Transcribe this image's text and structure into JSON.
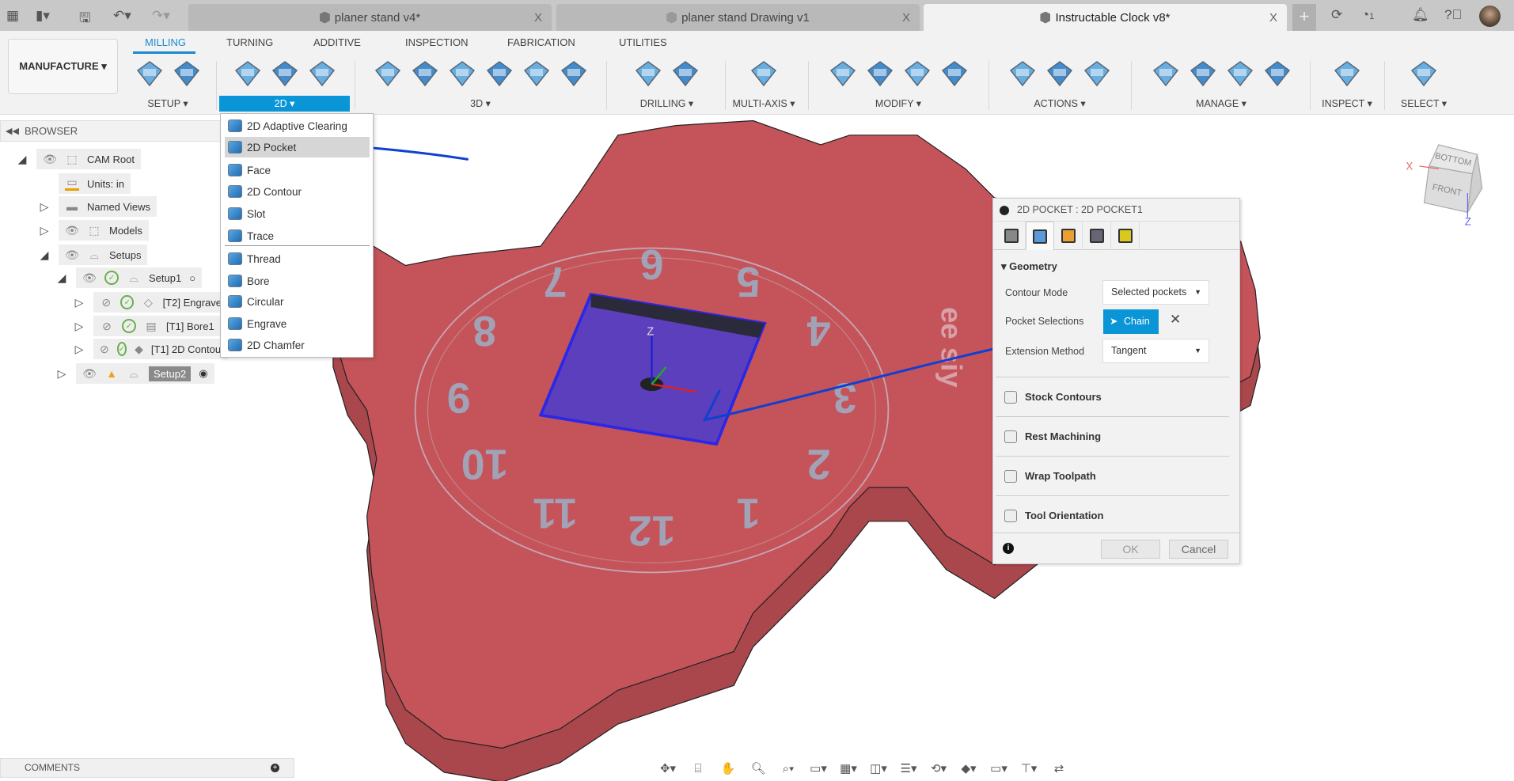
{
  "quick_access": {
    "icons": [
      "apps-grid-icon",
      "file-icon",
      "save-icon",
      "undo-icon",
      "redo-icon"
    ]
  },
  "doc_tabs": [
    {
      "title": "planer stand v4*",
      "icon": "component-icon",
      "active": false
    },
    {
      "title": "planer stand Drawing v1",
      "icon": "drawing-icon",
      "active": false
    },
    {
      "title": "Instructable Clock v8*",
      "icon": "component-icon",
      "active": true
    }
  ],
  "top_right": {
    "job_count": "1",
    "icons": [
      "new-tab-plus-icon",
      "sync-icon",
      "job-status-icon",
      "notification-bell-icon",
      "help-icon",
      "user-avatar"
    ]
  },
  "workspace": {
    "label": "MANUFACTURE ▾"
  },
  "ribbon_tabs": [
    "MILLING",
    "TURNING",
    "ADDITIVE",
    "INSPECTION",
    "FABRICATION",
    "UTILITIES"
  ],
  "groups": [
    {
      "label": "SETUP ▾",
      "icons": [
        "setup-folder-icon",
        "nc-program-icon"
      ]
    },
    {
      "label": "2D ▾",
      "active": true,
      "icons": [
        "2d-adaptive-icon",
        "2d-pocket-icon",
        "2d-contour-icon"
      ]
    },
    {
      "label": "3D ▾",
      "icons": [
        "3d-adaptive-icon",
        "3d-pocket-icon",
        "3d-steep-shallow-icon",
        "3d-flow-icon",
        "3d-scallop-icon",
        "3d-contour-icon"
      ]
    },
    {
      "label": "DRILLING ▾",
      "icons": [
        "drill-icon",
        "hole-recognition-icon"
      ]
    },
    {
      "label": "MULTI-AXIS ▾",
      "icons": [
        "multi-axis-icon"
      ]
    },
    {
      "label": "MODIFY ▾",
      "icons": [
        "trim-icon",
        "delete-toolpath-icon",
        "move-tool-icon",
        "edit-points-icon"
      ]
    },
    {
      "label": "ACTIONS ▾",
      "icons": [
        "simulate-icon",
        "post-process-icon",
        "setup-sheet-icon"
      ]
    },
    {
      "label": "MANAGE ▾",
      "icons": [
        "tool-library-icon",
        "machine-library-icon",
        "post-library-icon",
        "template-library-icon"
      ]
    },
    {
      "label": "INSPECT ▾",
      "icons": [
        "measure-icon"
      ]
    },
    {
      "label": "SELECT ▾",
      "icons": [
        "window-select-icon"
      ]
    }
  ],
  "browser": {
    "title": "BROWSER",
    "rows": [
      {
        "label": "CAM Root",
        "level": 0,
        "exp": "open",
        "icons": [
          "eye",
          "component"
        ]
      },
      {
        "label": "Units: in",
        "level": 1,
        "exp": "",
        "icons": [
          "units"
        ]
      },
      {
        "label": "Named Views",
        "level": 1,
        "exp": "closed",
        "icons": [
          "folder"
        ]
      },
      {
        "label": "Models",
        "level": 1,
        "exp": "closed",
        "icons": [
          "eye",
          "component"
        ]
      },
      {
        "label": "Setups",
        "level": 1,
        "exp": "open",
        "icons": [
          "eye",
          "folder-open"
        ]
      },
      {
        "label": "Setup1",
        "level": 2,
        "exp": "open",
        "icons": [
          "eye",
          "check",
          "folder-open"
        ],
        "suffix": "○"
      },
      {
        "label": "[T2] Engrave",
        "level": 3,
        "exp": "closed",
        "icons": [
          "eye-hidden",
          "check",
          "engrave"
        ]
      },
      {
        "label": "[T1] Bore1",
        "level": 3,
        "exp": "closed",
        "icons": [
          "eye-hidden",
          "check",
          "bore"
        ]
      },
      {
        "label": "[T1] 2D Contour",
        "level": 3,
        "exp": "closed",
        "icons": [
          "eye-hidden",
          "check",
          "contour"
        ]
      },
      {
        "label": "Setup2",
        "level": 2,
        "exp": "closed",
        "icons": [
          "eye",
          "warning",
          "folder-open"
        ],
        "selected": true,
        "suffix": "◉"
      }
    ]
  },
  "menu_2d": {
    "items": [
      "2D Adaptive Clearing",
      "2D Pocket",
      "Face",
      "2D Contour",
      "Slot",
      "Trace",
      "Thread",
      "Bore",
      "Circular",
      "Engrave",
      "2D Chamfer"
    ],
    "highlighted": "2D Pocket"
  },
  "dialog": {
    "title": "2D POCKET : 2D POCKET1",
    "tabs": [
      "tool-tab-icon",
      "geometry-tab-icon",
      "heights-tab-icon",
      "passes-tab-icon",
      "linking-tab-icon"
    ],
    "geometry_header": "Geometry",
    "contour_mode": {
      "label": "Contour Mode",
      "value": "Selected pockets"
    },
    "pocket_selections": {
      "label": "Pocket Selections",
      "button": "Chain"
    },
    "extension_method": {
      "label": "Extension Method",
      "value": "Tangent"
    },
    "sections": [
      "Stock Contours",
      "Rest Machining",
      "Wrap Toolpath",
      "Tool Orientation"
    ],
    "ok": "OK",
    "cancel": "Cancel"
  },
  "viewcube": {
    "top": "BOTTOM",
    "front": "FRONT",
    "axis_x": "X",
    "axis_z": "Z"
  },
  "model": {
    "clock_numbers": [
      "12",
      "1",
      "2",
      "3",
      "4",
      "5",
      "6",
      "7",
      "8",
      "9",
      "10",
      "11"
    ],
    "triad_z": "Z",
    "side_text": "ee\nsiy"
  },
  "comments": {
    "label": "COMMENTS"
  },
  "colors": {
    "accent": "#0a96d6",
    "model_top": "#c4545a",
    "model_side": "#a9474d",
    "annotation": "#1040d0",
    "pocket": "#4a3ccf"
  }
}
